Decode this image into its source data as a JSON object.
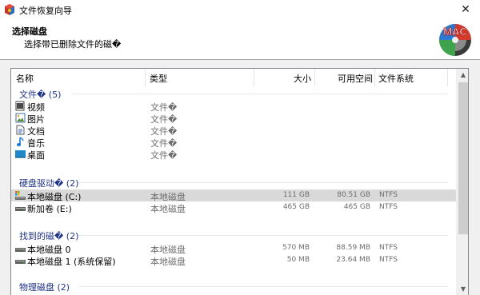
{
  "window": {
    "title": "文件恢复向导"
  },
  "header": {
    "title": "选择磁盘",
    "subtitle": "选择带已删除文件的磁�",
    "logo_text": "MAC"
  },
  "columns": {
    "name": "名称",
    "type": "类型",
    "size": "大小",
    "free": "可用空间",
    "fs": "文件系统"
  },
  "groups": [
    {
      "label": "文件� (5)",
      "items": [
        {
          "name": "视频",
          "type": "文件�",
          "icon": "video-icon"
        },
        {
          "name": "图片",
          "type": "文件�",
          "icon": "picture-icon"
        },
        {
          "name": "文档",
          "type": "文件�",
          "icon": "document-icon"
        },
        {
          "name": "音乐",
          "type": "文件�",
          "icon": "music-icon"
        },
        {
          "name": "桌面",
          "type": "文件�",
          "icon": "desktop-icon"
        }
      ]
    },
    {
      "label": "硬盘驱动� (2)",
      "items": [
        {
          "name": "本地磁盘 (C:)",
          "type": "本地磁盘",
          "size": "111 GB",
          "free": "80.51 GB",
          "fs": "NTFS",
          "icon": "system-drive-icon",
          "selected": true
        },
        {
          "name": "新加卷 (E:)",
          "type": "本地磁盘",
          "size": "465 GB",
          "free": "465 GB",
          "fs": "NTFS",
          "icon": "drive-icon"
        }
      ]
    },
    {
      "label": "找到的磁� (2)",
      "items": [
        {
          "name": "本地磁盘 0",
          "type": "本地磁盘",
          "size": "570 MB",
          "free": "88.59 MB",
          "fs": "NTFS",
          "icon": "drive-icon"
        },
        {
          "name": "本地磁盘 1 (系统保留)",
          "type": "本地磁盘",
          "size": "50 MB",
          "free": "23.64 MB",
          "fs": "NTFS",
          "icon": "drive-icon"
        }
      ]
    },
    {
      "label": "物理磁盘 (2)",
      "items": []
    }
  ],
  "colors": {
    "group_header": "#1e3287",
    "selected_row": "#d9d9d9",
    "secondary_text": "#6d6d6d"
  }
}
